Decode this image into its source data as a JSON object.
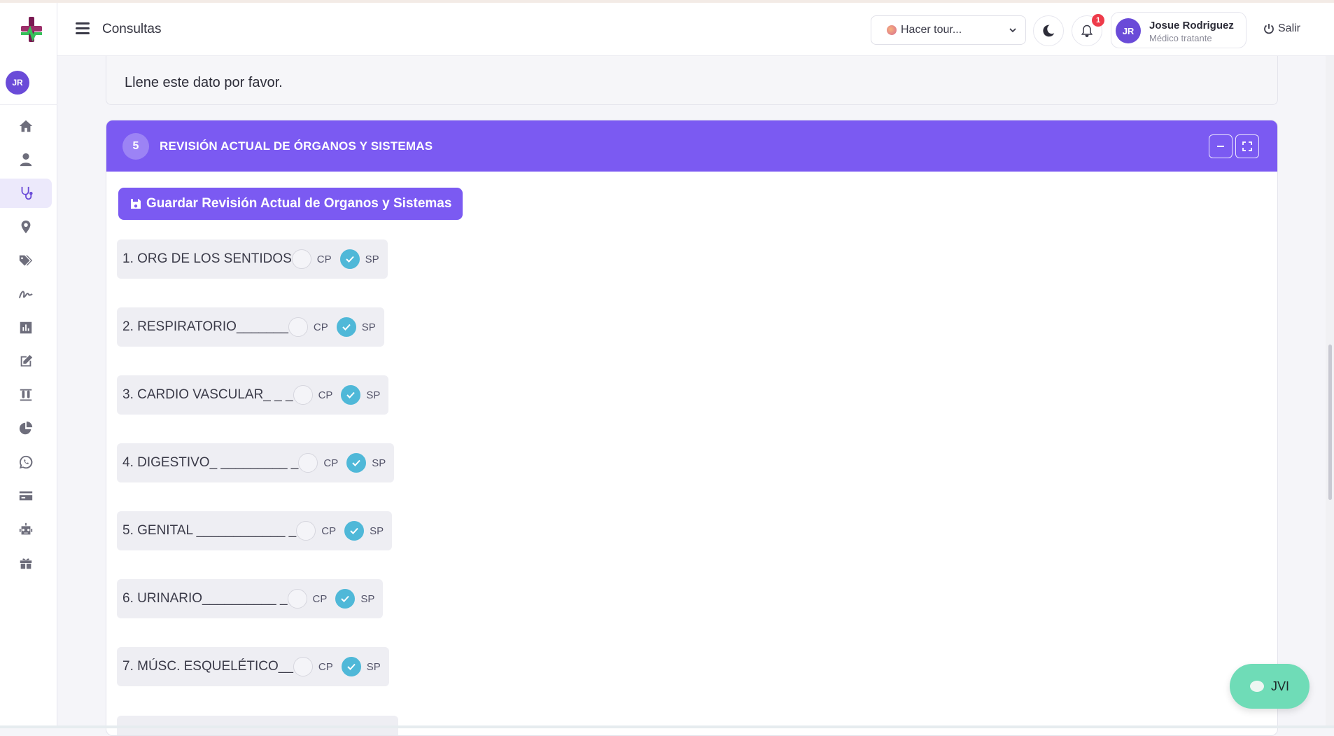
{
  "sidebar": {
    "avatar_initials": "JR",
    "items": [
      {
        "name": "home",
        "icon": "home-icon"
      },
      {
        "name": "user",
        "icon": "user-icon"
      },
      {
        "name": "stethoscope",
        "icon": "stethoscope-icon",
        "active": true
      },
      {
        "name": "location",
        "icon": "map-pin-icon"
      },
      {
        "name": "tags",
        "icon": "tags-icon"
      },
      {
        "name": "signature",
        "icon": "signature-icon"
      },
      {
        "name": "chart",
        "icon": "bar-chart-icon"
      },
      {
        "name": "edit",
        "icon": "edit-icon"
      },
      {
        "name": "lab",
        "icon": "test-tubes-icon"
      },
      {
        "name": "pie",
        "icon": "pie-chart-icon"
      },
      {
        "name": "whatsapp",
        "icon": "whatsapp-icon"
      },
      {
        "name": "card",
        "icon": "credit-card-icon"
      },
      {
        "name": "robot",
        "icon": "robot-icon"
      },
      {
        "name": "gift",
        "icon": "gift-icon"
      }
    ]
  },
  "header": {
    "title": "Consultas",
    "tour_label": "Hacer tour...",
    "notification_count": "1",
    "user": {
      "initials": "JR",
      "name": "Josue Rodriguez",
      "role": "Médico tratante"
    },
    "logout_label": "Salir"
  },
  "previous_section": {
    "message": "Llene este dato por favor."
  },
  "section": {
    "number": "5",
    "title": "REVISIÓN ACTUAL DE ÓRGANOS Y SISTEMAS",
    "save_label": "Guardar Revisión Actual de Organos y Sistemas",
    "option_cp": "CP",
    "option_sp": "SP",
    "rows": [
      {
        "label": "1. ORG DE LOS SENTIDOS",
        "selected": "SP"
      },
      {
        "label": "2. RESPIRATORIO_______",
        "selected": "SP"
      },
      {
        "label": "3. CARDIO VASCULAR_ _ _",
        "selected": "SP"
      },
      {
        "label": "4. DIGESTIVO_ _________ _",
        "selected": "SP"
      },
      {
        "label": "5. GENITAL ____________ _",
        "selected": "SP"
      },
      {
        "label": "6. URINARIO__________ _",
        "selected": "SP"
      },
      {
        "label": "7. MÚSC. ESQUELÉTICO__",
        "selected": "SP"
      }
    ]
  },
  "chat_widget": {
    "label": "JVI"
  },
  "colors": {
    "accent": "#7b5af2",
    "checked": "#4fb8d8",
    "chat": "#6fdcb7",
    "badge": "#ee3b4a"
  }
}
